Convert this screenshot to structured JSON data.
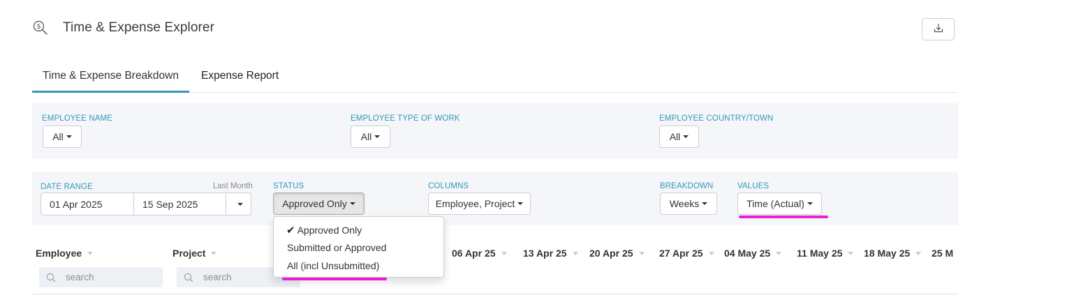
{
  "header": {
    "title": "Time & Expense Explorer",
    "icon": "search-dollar-icon",
    "download_icon": "download-icon"
  },
  "tabs": [
    {
      "label": "Time & Expense Breakdown",
      "active": true
    },
    {
      "label": "Expense Report",
      "active": false
    }
  ],
  "filters_row1": {
    "employee_name": {
      "label": "EMPLOYEE NAME",
      "value": "All"
    },
    "employee_type": {
      "label": "EMPLOYEE TYPE OF WORK",
      "value": "All"
    },
    "employee_country": {
      "label": "EMPLOYEE COUNTRY/TOWN",
      "value": "All"
    }
  },
  "filters_row2": {
    "date_range": {
      "label": "DATE RANGE",
      "preset": "Last Month",
      "from": "01 Apr 2025",
      "to": "15 Sep 2025"
    },
    "status": {
      "label": "STATUS",
      "value": "Approved Only"
    },
    "columns": {
      "label": "COLUMNS",
      "value": "Employee, Project"
    },
    "breakdown": {
      "label": "BREAKDOWN",
      "value": "Weeks"
    },
    "values": {
      "label": "VALUES",
      "value": "Time (Actual)"
    }
  },
  "status_menu": {
    "options": [
      "Approved Only",
      "Submitted or Approved",
      "All (incl Unsubmitted)"
    ],
    "selected": "Approved Only"
  },
  "grid": {
    "employee_header": "Employee",
    "project_header": "Project",
    "employee_search_placeholder": "search",
    "project_search_placeholder": "search",
    "week_columns": [
      "06 Apr 25",
      "13 Apr 25",
      "20 Apr 25",
      "27 Apr 25",
      "04 May 25",
      "11 May 25",
      "18 May 25",
      "25 M"
    ]
  },
  "colors": {
    "accent": "#3597b8",
    "highlight": "#ea1fd6",
    "panel_bg": "#f4f6f9"
  }
}
